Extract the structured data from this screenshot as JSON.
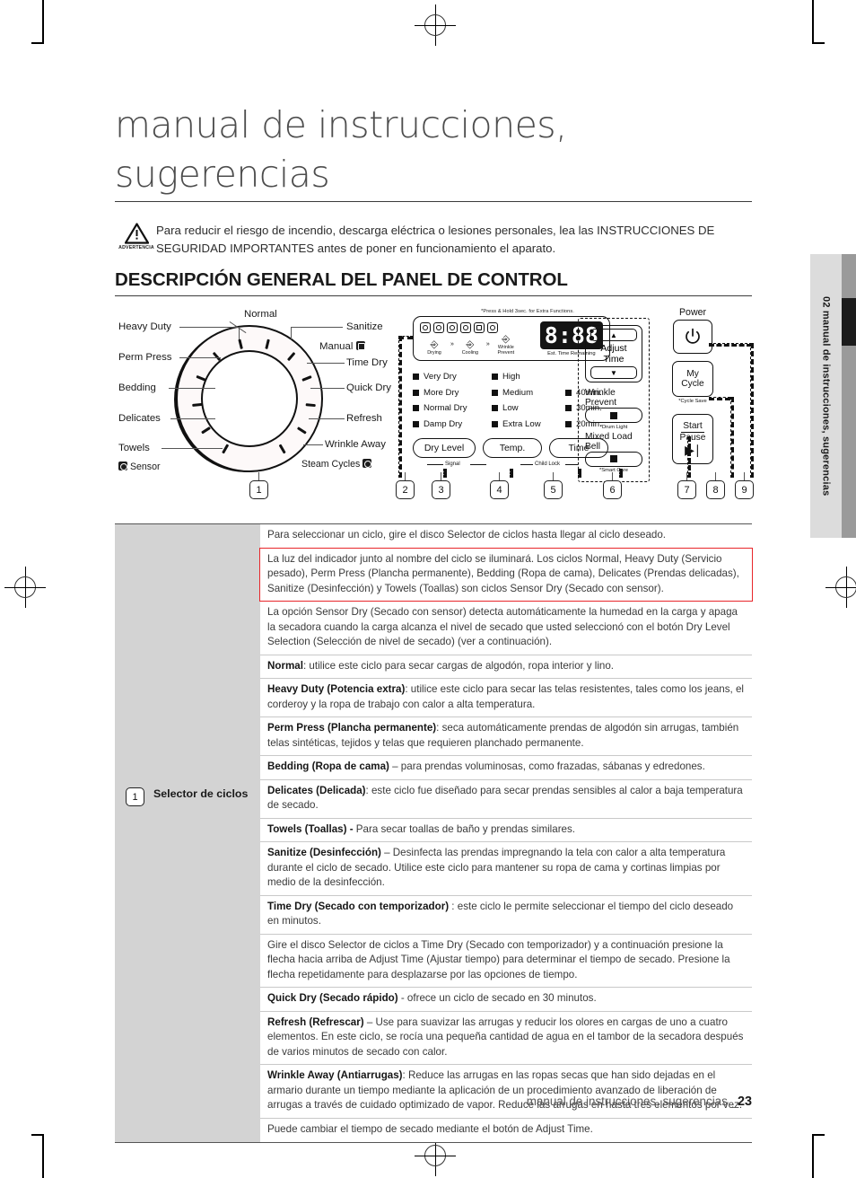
{
  "document": {
    "title_line1": "manual de instrucciones,",
    "title_line2": "sugerencias",
    "warning_label": "ADVERTENCIA",
    "warning_text": "Para reducir el riesgo de incendio, descarga eléctrica o lesiones personales, lea las INSTRUCCIONES DE SEGURIDAD IMPORTANTES antes de poner en funcionamiento el aparato.",
    "section_heading": "DESCRIPCIÓN GENERAL DEL PANEL DE CONTROL",
    "side_tab": "02 manual de instrucciones, sugerencias",
    "footer_text": "manual de instrucciones, sugerencias _",
    "footer_page": "23"
  },
  "panel": {
    "dial": {
      "left_labels": [
        "Heavy Duty",
        "Perm Press",
        "Bedding",
        "Delicates",
        "Towels"
      ],
      "top_label": "Normal",
      "right_labels": [
        "Sanitize",
        "Time Dry",
        "Quick Dry",
        "Refresh",
        "Wrinkle Away"
      ],
      "manual_label": "Manual",
      "sensor_label": "Sensor",
      "steam_label": "Steam Cycles"
    },
    "display": {
      "press_hold_note": "*Press & Hold 3sec. for Extra Functions.",
      "stages": [
        "Drying",
        "Cooling",
        "Wrinkle Prevent"
      ],
      "lcd_value": "8:88",
      "lcd_caption": "Est. Time Remaining"
    },
    "indicators": {
      "dry_level": [
        "Very Dry",
        "More Dry",
        "Normal Dry",
        "Damp Dry"
      ],
      "temp": [
        "High",
        "Medium",
        "Low",
        "Extra Low"
      ],
      "time": [
        "40min.",
        "30min.",
        "20min."
      ]
    },
    "pill_buttons": [
      "Dry Level",
      "Temp.",
      "Time"
    ],
    "pill_sublabels": [
      "Signal",
      "Child Lock"
    ],
    "right_group": {
      "adjust_time": "Adjust Time",
      "up_arrow": "▲",
      "down_arrow": "▼",
      "wrinkle_prevent": "Wrinkle Prevent",
      "wrinkle_prevent_star": "*Drum Light",
      "mixed_load_bell": "Mixed Load Bell",
      "mixed_load_star": "*Smart Care"
    },
    "power_group": {
      "power_label": "Power",
      "my_cycle_line1": "My",
      "my_cycle_line2": "Cycle",
      "my_cycle_star": "*Cycle Save",
      "start_line1": "Start",
      "start_line2": "Pause"
    },
    "callouts": [
      "1",
      "2",
      "3",
      "4",
      "5",
      "6",
      "7",
      "8",
      "9"
    ]
  },
  "table": {
    "left_callout": "1",
    "left_label": "Selector de ciclos",
    "rows": [
      {
        "html": "Para seleccionar un ciclo, gire el disco Selector de ciclos hasta llegar al ciclo deseado.",
        "highlight": false
      },
      {
        "html": "La luz del indicador junto al nombre del ciclo se iluminará. Los ciclos Normal, Heavy Duty (Servicio pesado), Perm Press (Plancha permanente), Bedding (Ropa de cama), Delicates (Prendas delicadas), Sanitize (Desinfección) y Towels (Toallas) son ciclos Sensor Dry (Secado con sensor).",
        "highlight": true
      },
      {
        "html": "La opción Sensor Dry (Secado con sensor) detecta automáticamente la humedad en la carga y apaga la secadora cuando la carga alcanza el nivel de secado que usted seleccionó con el botón Dry Level Selection (Selección de nivel de secado) (ver a continuación).",
        "highlight": false
      },
      {
        "html": "<b>Normal</b>: utilice este ciclo para secar cargas de algodón, ropa interior y lino.",
        "highlight": false
      },
      {
        "html": "<b>Heavy Duty (Potencia extra)</b>: utilice este ciclo para secar las telas resistentes, tales como los jeans, el corderoy y la ropa de trabajo con calor a alta temperatura.",
        "highlight": false
      },
      {
        "html": "<b>Perm Press (Plancha permanente)</b>: seca automáticamente prendas de algodón sin arrugas, también telas sintéticas, tejidos y telas que requieren planchado permanente.",
        "highlight": false
      },
      {
        "html": "<b>Bedding (Ropa de cama)</b> – para prendas voluminosas, como frazadas, sábanas y edredones.",
        "highlight": false
      },
      {
        "html": "<b>Delicates (Delicada)</b>: este ciclo fue diseñado para secar prendas sensibles al calor a baja temperatura de secado.",
        "highlight": false
      },
      {
        "html": "<b>Towels (Toallas) -</b> Para secar toallas de baño y prendas similares.",
        "highlight": false
      },
      {
        "html": "<b>Sanitize (Desinfección)</b> – Desinfecta las prendas impregnando la tela con calor a alta temperatura durante el ciclo de secado. Utilice este ciclo para mantener su ropa de cama y cortinas limpias por medio de la desinfección.",
        "highlight": false
      },
      {
        "html": "<b>Time Dry (Secado con temporizador)</b> : este ciclo le permite seleccionar el tiempo del ciclo deseado en minutos.",
        "highlight": false
      },
      {
        "html": "Gire el disco Selector de ciclos a Time Dry (Secado con temporizador) y a continuación presione la flecha hacia arriba de Adjust Time (Ajustar tiempo) para determinar el tiempo de secado. Presione la flecha repetidamente para desplazarse por las opciones de tiempo.",
        "highlight": false
      },
      {
        "html": "<b>Quick Dry (Secado rápido)</b> - ofrece un ciclo de secado en 30 minutos.",
        "highlight": false
      },
      {
        "html": "<b>Refresh (Refrescar)</b> – Use para suavizar las arrugas y reducir los olores en cargas de uno a cuatro elementos. En este ciclo, se rocía una pequeña cantidad de agua en el tambor de la secadora después de varios minutos de secado con calor.",
        "highlight": false
      },
      {
        "html": "<b>Wrinkle Away (Antiarrugas)</b>: Reduce las arrugas en las ropas secas que han sido dejadas en el armario durante un tiempo mediante la aplicación de un procedimiento avanzado de liberación de arrugas a través de cuidado optimizado de vapor. Reduce las arrugas en hasta tres elementos por vez.",
        "highlight": false
      },
      {
        "html": "Puede cambiar el tiempo de secado mediante el botón de Adjust Time.",
        "highlight": false
      }
    ]
  }
}
